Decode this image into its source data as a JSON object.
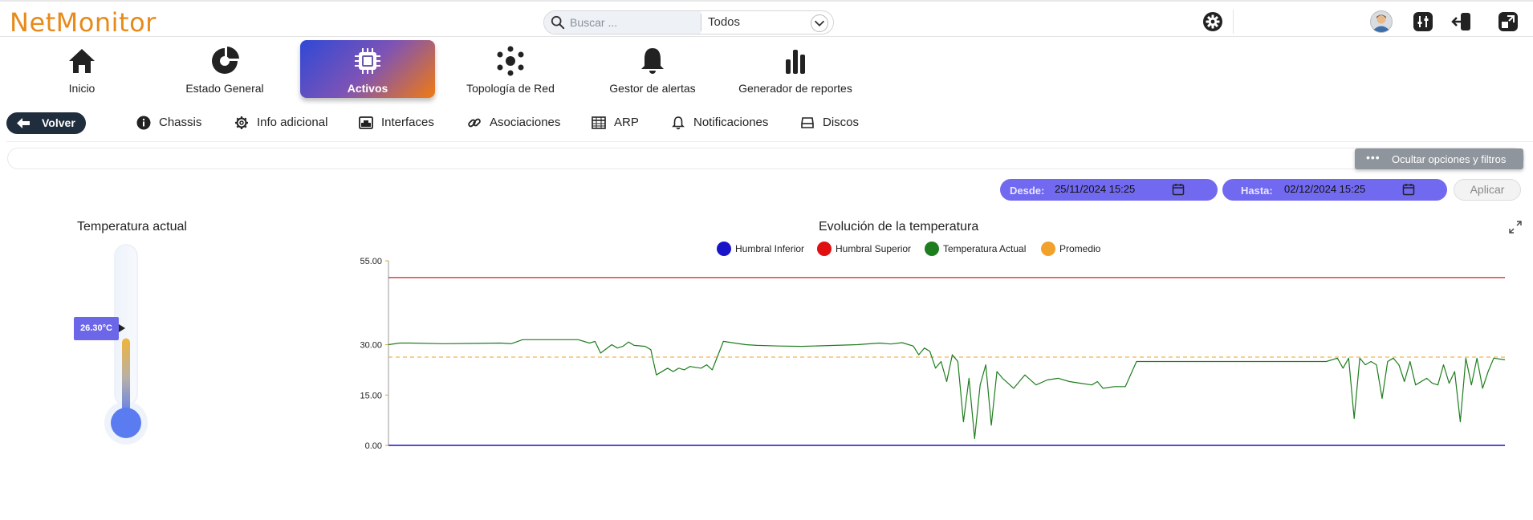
{
  "app": {
    "logo": "NetMonitor"
  },
  "search": {
    "placeholder": "Buscar ...",
    "scope": "Todos"
  },
  "topbar_icons": [
    "settings-gear-icon",
    "user-avatar",
    "sliders-icon",
    "logout-icon",
    "switch-window-icon"
  ],
  "nav": {
    "items": [
      {
        "label": "Inicio",
        "icon": "home-icon"
      },
      {
        "label": "Estado General",
        "icon": "status-chart-icon"
      },
      {
        "label": "Activos",
        "icon": "chip-icon",
        "active": true
      },
      {
        "label": "Topología de Red",
        "icon": "topology-icon"
      },
      {
        "label": "Gestor de alertas",
        "icon": "bell-icon"
      },
      {
        "label": "Generador de reportes",
        "icon": "bar-chart-icon"
      }
    ]
  },
  "subnav": {
    "back_label": "Volver",
    "items": [
      {
        "label": "Chassis",
        "icon": "info-icon"
      },
      {
        "label": "Info adicional",
        "icon": "gear-icon"
      },
      {
        "label": "Interfaces",
        "icon": "interface-icon"
      },
      {
        "label": "Asociaciones",
        "icon": "link-icon"
      },
      {
        "label": "ARP",
        "icon": "table-icon"
      },
      {
        "label": "Notificaciones",
        "icon": "bell-icon"
      },
      {
        "label": "Discos",
        "icon": "disk-icon"
      }
    ]
  },
  "filters": {
    "toggle_label": "Ocultar opciones y filtros",
    "from_label": "Desde:",
    "from_value": "25/11/2024 15:25",
    "to_label": "Hasta:",
    "to_value": "02/12/2024 15:25",
    "apply_label": "Aplicar"
  },
  "gauge": {
    "title": "Temperatura actual",
    "value_label": "26.30°C",
    "level_fraction": 0.48
  },
  "colors": {
    "accent": "#7169f0",
    "lower_threshold": "#1a14c8",
    "upper_threshold": "#d91d1d",
    "current": "#1e7d1e",
    "average": "#f2a12a"
  },
  "chart_data": {
    "type": "line",
    "title": "Evolución de la temperatura",
    "x_range": [
      "25/11/2024 15:25",
      "02/12/2024 15:25"
    ],
    "ylim": [
      0,
      55
    ],
    "y_ticks": [
      "55.00",
      "30.00",
      "15.00",
      "0.00"
    ],
    "legend": [
      "Humbral Inferior",
      "Humbral Superior",
      "Temperatura Actual",
      "Promedio"
    ],
    "legend_position": "top-center",
    "series": [
      {
        "name": "Humbral Inferior",
        "constant": 0
      },
      {
        "name": "Humbral Superior",
        "constant": 50
      },
      {
        "name": "Promedio",
        "constant": 26.3,
        "style": "dashed"
      },
      {
        "name": "Temperatura Actual",
        "x_fraction": [
          0.0,
          0.01,
          0.02,
          0.05,
          0.08,
          0.1,
          0.11,
          0.12,
          0.15,
          0.17,
          0.18,
          0.185,
          0.19,
          0.2,
          0.205,
          0.21,
          0.215,
          0.22,
          0.23,
          0.235,
          0.24,
          0.25,
          0.255,
          0.26,
          0.265,
          0.27,
          0.28,
          0.285,
          0.29,
          0.3,
          0.31,
          0.32,
          0.33,
          0.35,
          0.37,
          0.4,
          0.42,
          0.44,
          0.45,
          0.46,
          0.47,
          0.475,
          0.48,
          0.485,
          0.49,
          0.495,
          0.5,
          0.505,
          0.51,
          0.515,
          0.52,
          0.525,
          0.53,
          0.535,
          0.54,
          0.545,
          0.55,
          0.56,
          0.57,
          0.58,
          0.59,
          0.6,
          0.61,
          0.62,
          0.63,
          0.635,
          0.64,
          0.65,
          0.66,
          0.67,
          0.68,
          0.7,
          0.72,
          0.74,
          0.76,
          0.78,
          0.8,
          0.82,
          0.84,
          0.85,
          0.855,
          0.86,
          0.865,
          0.87,
          0.875,
          0.88,
          0.885,
          0.89,
          0.895,
          0.9,
          0.905,
          0.91,
          0.915,
          0.92,
          0.93,
          0.935,
          0.94,
          0.945,
          0.95,
          0.955,
          0.96,
          0.965,
          0.97,
          0.975,
          0.98,
          0.985,
          0.99,
          1.0
        ],
        "values": [
          30,
          30.5,
          30.5,
          30.3,
          30.4,
          30.5,
          30.3,
          31.5,
          31.5,
          31.5,
          30.5,
          31,
          27.5,
          30,
          29,
          29.5,
          30.8,
          29.8,
          29.5,
          28.5,
          21,
          23,
          22,
          23,
          22.5,
          23.5,
          23,
          24,
          22.5,
          31,
          30.5,
          30,
          29.8,
          29.6,
          29.5,
          29.8,
          30,
          30.5,
          30.2,
          30.6,
          29.6,
          27,
          29,
          28,
          23,
          25,
          19,
          27,
          25,
          7,
          20,
          2,
          18,
          24,
          6,
          22,
          20,
          17,
          21,
          18,
          19.5,
          20,
          19,
          18.5,
          18,
          19,
          17,
          17.5,
          17.5,
          25,
          25,
          25,
          25,
          25,
          25,
          25,
          25,
          25,
          25,
          26,
          23,
          26,
          8,
          26,
          24,
          25,
          24,
          14,
          25,
          26,
          24,
          19,
          25,
          18,
          20,
          18.5,
          18,
          24,
          18.5,
          22,
          7,
          26,
          18,
          26,
          17,
          22,
          26,
          25.5,
          26,
          27
        ]
      }
    ]
  }
}
